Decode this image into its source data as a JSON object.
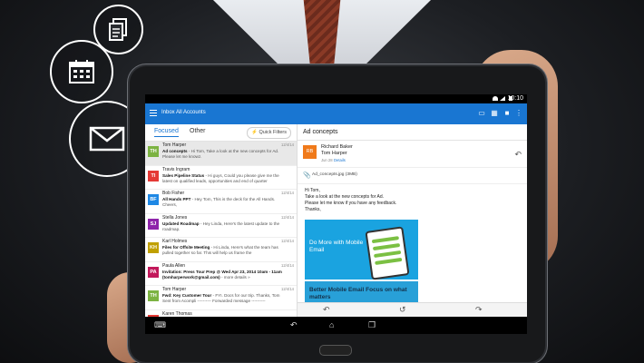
{
  "status_bar": {
    "time": "10:10"
  },
  "app_bar": {
    "title": "Inbox All Accounts",
    "icons": [
      "hamburger-icon",
      "folder-icon",
      "calendar-icon",
      "people-icon",
      "more-icon"
    ]
  },
  "tabs": {
    "focused": "Focused",
    "other": "Other",
    "quick_filters": "Quick Filters"
  },
  "emails": [
    {
      "sender": "Tom Harper",
      "date": "12/4/14",
      "avatar_letter": "TH",
      "avatar_color": "#7cb342",
      "subject": "Ad concepts",
      "preview": " - Hi Tom, Take a look at the new concepts for Ad. Please let me knowz.",
      "selected": true
    },
    {
      "sender": "Travis Ingram",
      "date": "",
      "avatar_letter": "TI",
      "avatar_color": "#e53935",
      "subject": "Sales Pipeline Status",
      "preview": " - Hi guys, Could you please give me the latest on qualified leads, opportunities and end of quarter",
      "selected": false
    },
    {
      "sender": "Bob Fisher",
      "date": "12/4/14",
      "avatar_letter": "BF",
      "avatar_color": "#1e88e5",
      "subject": "All Hands PPT",
      "preview": " - Hey Tom, This is the deck for the All Hands. Cheers,",
      "selected": false
    },
    {
      "sender": "Stella Jones",
      "date": "12/4/14",
      "avatar_letter": "SJ",
      "avatar_color": "#8e24aa",
      "subject": "Updated Roadmap",
      "preview": " - Hey Linda, Here's the latest update to the roadmap.",
      "selected": false
    },
    {
      "sender": "Karl Holmes",
      "date": "12/4/14",
      "avatar_letter": "KH",
      "avatar_color": "#c0a000",
      "subject": "Files for Offsite Meeting",
      "preview": " - Hi Linda, Here's what the team has pulled together so far. This will help us frame the",
      "selected": false
    },
    {
      "sender": "Paula Allen",
      "date": "12/4/14",
      "avatar_letter": "PA",
      "avatar_color": "#c2185b",
      "subject": "Invitation: Press Tour Prep @ Wed Apr 23, 2014 10am - 11am (tomharperwork@gmail.com)",
      "preview": " - more details »",
      "selected": false
    },
    {
      "sender": "Tom Harper",
      "date": "12/4/14",
      "avatar_letter": "TH",
      "avatar_color": "#7cb342",
      "subject": "Fwd: Key Customer Tour",
      "preview": " - FYI. Docs for our trip. Thanks, Tom Sent from Acompli ---------- Forwarded message ----------",
      "selected": false
    },
    {
      "sender": "Karen Thomas",
      "date": "",
      "avatar_letter": "KT",
      "avatar_color": "#e53935",
      "subject": "",
      "preview": "",
      "selected": false
    }
  ],
  "reading_pane": {
    "subject": "Ad concepts",
    "sender": "Richard Baker",
    "to": "Tom Harper",
    "date": "Jun 28",
    "details": "Details",
    "avatar_letter": "RB",
    "attachment": "Ad_concepts.jpg (3MB)",
    "body_lines": [
      "Hi Tom,",
      "Take a look at the new concepts for Ad.",
      "Please let me know if you have any feedback.",
      "Thanks,"
    ],
    "promo_top": "Do More with Mobile Email",
    "promo_bottom": "Better Mobile Email Focus on what matters"
  },
  "side_icons": [
    "document-icon",
    "calendar-icon",
    "mail-icon"
  ]
}
